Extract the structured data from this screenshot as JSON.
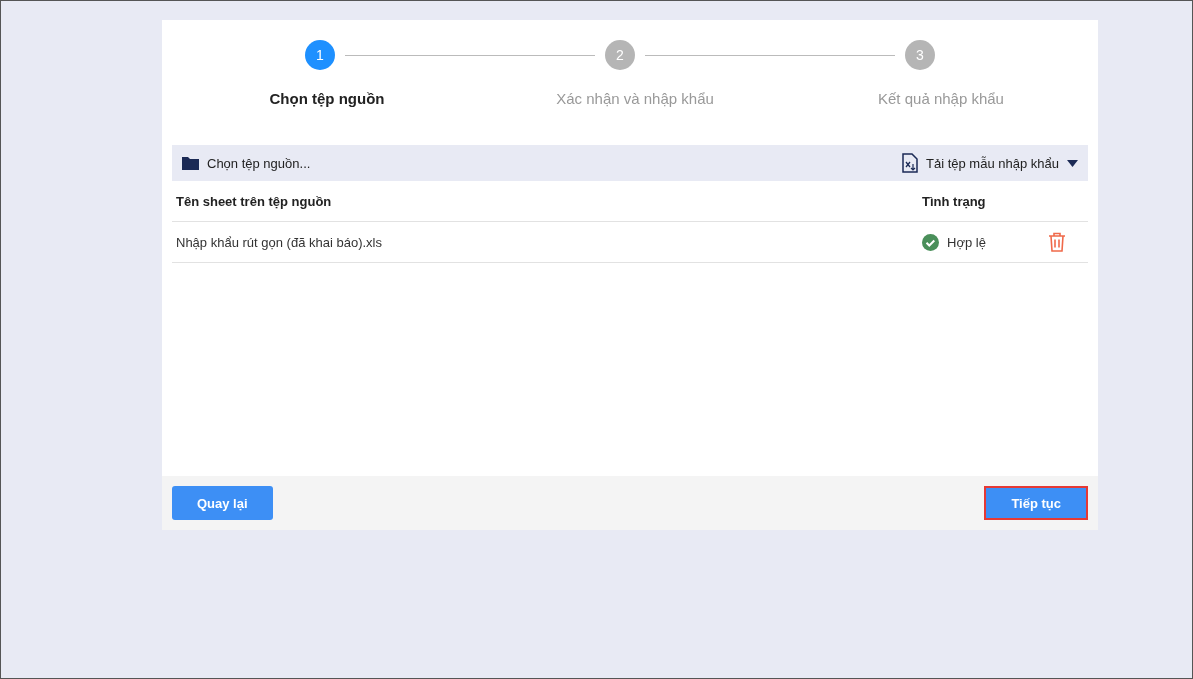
{
  "steps": [
    {
      "number": "1",
      "label": "Chọn tệp nguồn",
      "selected": true
    },
    {
      "number": "2",
      "label": "Xác nhận và nhập khẩu",
      "selected": false
    },
    {
      "number": "3",
      "label": "Kết quả nhập khẩu",
      "selected": false
    }
  ],
  "toolbar": {
    "choose_file": "Chọn tệp nguồn...",
    "download_template": "Tải tệp mẫu nhập khẩu"
  },
  "table": {
    "columns": [
      "Tên sheet trên tệp nguồn",
      "Tình trạng"
    ],
    "rows": [
      {
        "name": "Nhập khẩu rút gọn (đã khai báo).xls",
        "status": "Hợp lệ",
        "valid": true
      }
    ]
  },
  "footer": {
    "buttons": [
      {
        "label": "Quay lại",
        "highlighted": false
      },
      {
        "label": "Tiếp tục",
        "highlighted": true
      }
    ]
  }
}
